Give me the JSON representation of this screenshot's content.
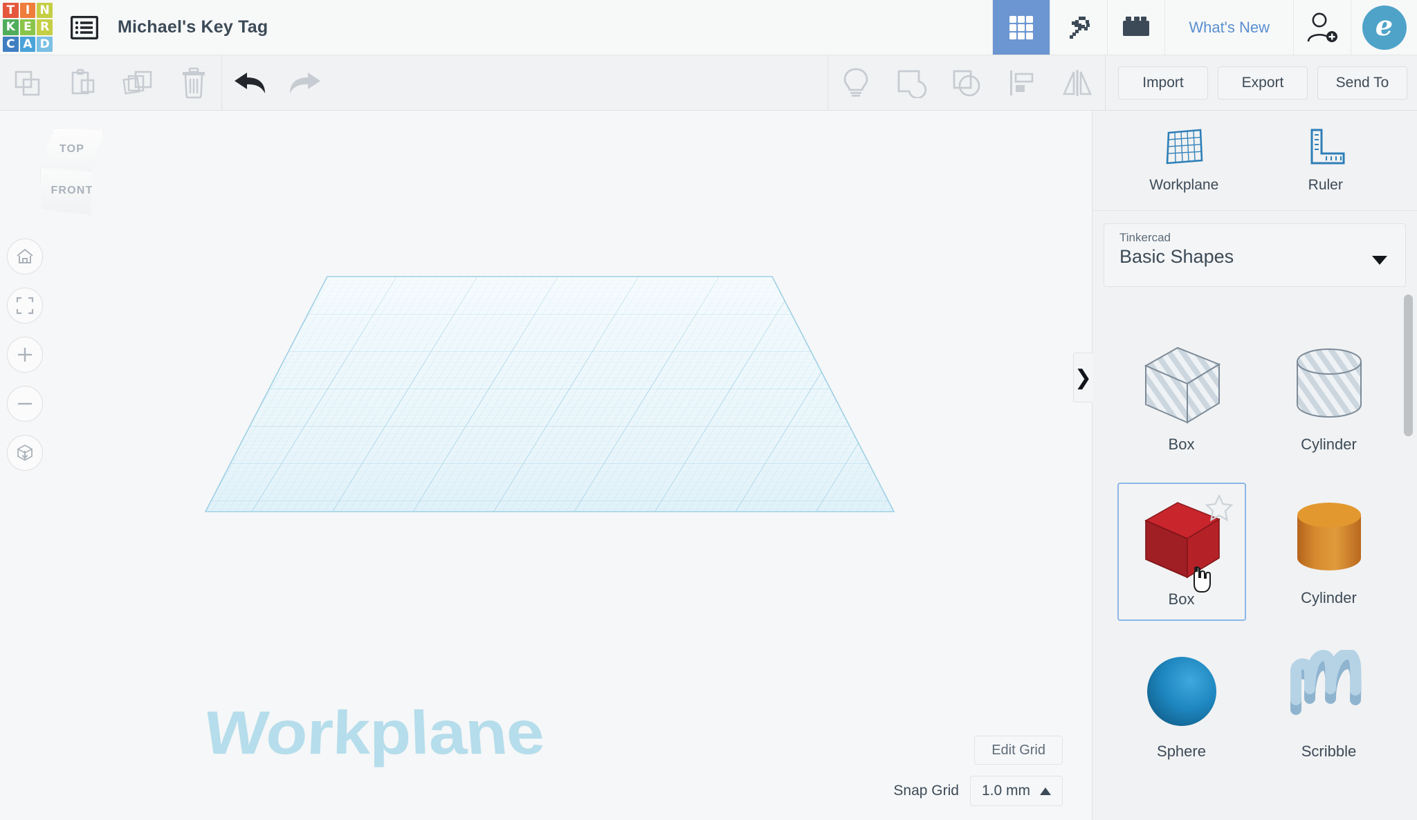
{
  "app": {
    "name": "Tinkercad",
    "logo_letters": [
      {
        "ch": "T",
        "color": "#e4573d"
      },
      {
        "ch": "I",
        "color": "#ef7d3b"
      },
      {
        "ch": "N",
        "color": "#c5cf45"
      },
      {
        "ch": "K",
        "color": "#4fad5b"
      },
      {
        "ch": "E",
        "color": "#8ac54a"
      },
      {
        "ch": "R",
        "color": "#c5cf45"
      },
      {
        "ch": "C",
        "color": "#3f7fc1"
      },
      {
        "ch": "A",
        "color": "#4aa3d8"
      },
      {
        "ch": "D",
        "color": "#7cc0e4"
      }
    ]
  },
  "header": {
    "menu_icon": "list-menu-icon",
    "doc_title": "Michael's Key Tag",
    "whats_new": "What's New",
    "avatar_initial": "e",
    "avatar_color": "#4fa3c9",
    "active_tab_color": "#6b96d1",
    "tabs": [
      {
        "name": "3d-designs",
        "icon": "grid-icon",
        "active": true
      },
      {
        "name": "minecraft",
        "icon": "pickaxe-icon",
        "active": false
      },
      {
        "name": "bricks",
        "icon": "lego-brick-icon",
        "active": false
      }
    ],
    "add_person_icon": "add-person-icon"
  },
  "toolbar": {
    "left_tools": [
      {
        "name": "copy",
        "icon": "copy-icon",
        "enabled": false
      },
      {
        "name": "paste",
        "icon": "paste-icon",
        "enabled": false
      },
      {
        "name": "duplicate",
        "icon": "duplicate-icon",
        "enabled": false
      },
      {
        "name": "delete",
        "icon": "trash-icon",
        "enabled": false
      }
    ],
    "history_tools": [
      {
        "name": "undo",
        "icon": "undo-arrow-icon",
        "enabled": true
      },
      {
        "name": "redo",
        "icon": "redo-arrow-icon",
        "enabled": false
      }
    ],
    "object_tools": [
      {
        "name": "hint",
        "icon": "lightbulb-icon",
        "enabled": false
      },
      {
        "name": "group",
        "icon": "group-icon",
        "enabled": false
      },
      {
        "name": "ungroup",
        "icon": "ungroup-icon",
        "enabled": false
      },
      {
        "name": "align",
        "icon": "align-icon",
        "enabled": false
      },
      {
        "name": "mirror",
        "icon": "mirror-icon",
        "enabled": false
      }
    ],
    "import_label": "Import",
    "export_label": "Export",
    "sendto_label": "Send To"
  },
  "viewport": {
    "viewcube": {
      "top_label": "TOP",
      "front_label": "FRONT"
    },
    "nav_buttons": [
      {
        "name": "home-view",
        "icon": "home-icon"
      },
      {
        "name": "fit-to-view",
        "icon": "fit-frame-icon"
      },
      {
        "name": "zoom-in",
        "icon": "plus-icon"
      },
      {
        "name": "zoom-out",
        "icon": "minus-icon"
      },
      {
        "name": "perspective-toggle",
        "icon": "cube-ortho-icon"
      }
    ],
    "workplane_text": "Workplane",
    "workplane_text_color": "#aedaea",
    "grid_color": "#9ecfe5",
    "edit_grid_label": "Edit Grid",
    "snap_grid_label": "Snap Grid",
    "snap_grid_value": "1.0 mm"
  },
  "panel": {
    "tools": [
      {
        "name": "workplane-tool",
        "label": "Workplane",
        "icon": "workplane-grid-icon"
      },
      {
        "name": "ruler-tool",
        "label": "Ruler",
        "icon": "ruler-icon"
      }
    ],
    "library_owner": "Tinkercad",
    "library_name": "Basic Shapes",
    "collapse_arrow": "❯",
    "shapes": [
      [
        {
          "name": "Box",
          "style": "hole",
          "selected": false
        },
        {
          "name": "Cylinder",
          "style": "hole",
          "selected": false
        }
      ],
      [
        {
          "name": "Box",
          "style": "solid",
          "color": "#b32424",
          "selected": true,
          "favorite": false
        },
        {
          "name": "Cylinder",
          "style": "solid",
          "color": "#d4862a",
          "selected": false
        }
      ],
      [
        {
          "name": "Sphere",
          "style": "solid",
          "color": "#1a86c2",
          "selected": false
        },
        {
          "name": "Scribble",
          "style": "solid",
          "color": "#9cc3dd",
          "selected": false
        }
      ]
    ]
  }
}
